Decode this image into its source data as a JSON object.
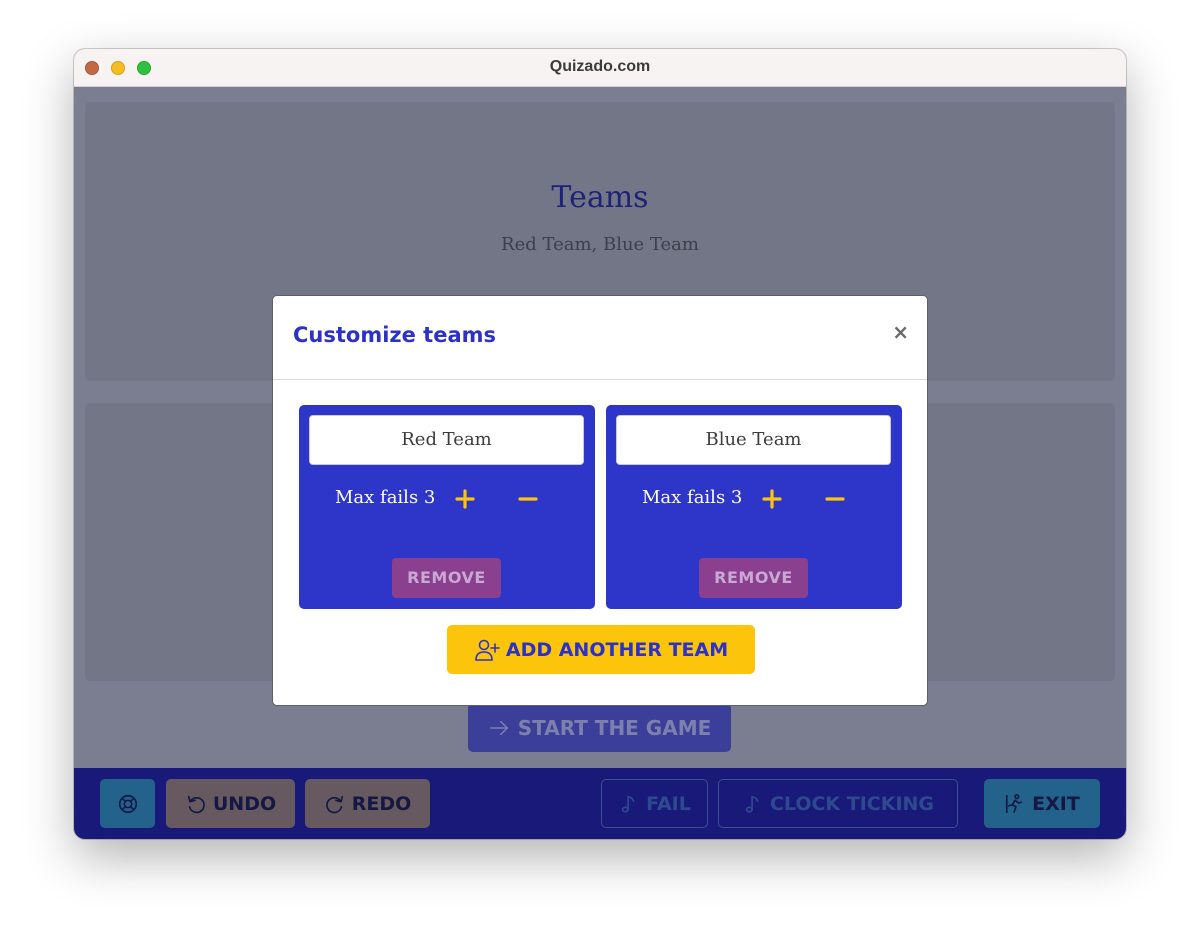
{
  "window": {
    "title": "Quizado.com"
  },
  "background": {
    "teams_heading": "Teams",
    "teams_subtitle": "Red Team, Blue Team",
    "start_label": "START THE GAME"
  },
  "bottombar": {
    "undo_label": "UNDO",
    "redo_label": "REDO",
    "fail_label": "FAIL",
    "clock_label": "CLOCK TICKING",
    "exit_label": "EXIT"
  },
  "modal": {
    "title": "Customize teams",
    "close_label": "×",
    "teams": [
      {
        "name": "Red Team",
        "max_fails_label": "Max fails 3",
        "remove_label": "REMOVE"
      },
      {
        "name": "Blue Team",
        "max_fails_label": "Max fails 3",
        "remove_label": "REMOVE"
      }
    ],
    "add_team_label": "ADD ANOTHER TEAM"
  },
  "icons": {
    "help": "lifebuoy-icon",
    "undo": "undo-arrow-icon",
    "redo": "redo-arrow-icon",
    "music": "music-note-icon",
    "exit": "running-person-icon",
    "start": "arrow-right-icon",
    "add_team": "add-user-icon"
  },
  "colors": {
    "accent_blue": "#2e35c9",
    "accent_yellow": "#fdc40c",
    "bar_navy": "#19197a",
    "remove_purple": "#8a3f8f"
  }
}
